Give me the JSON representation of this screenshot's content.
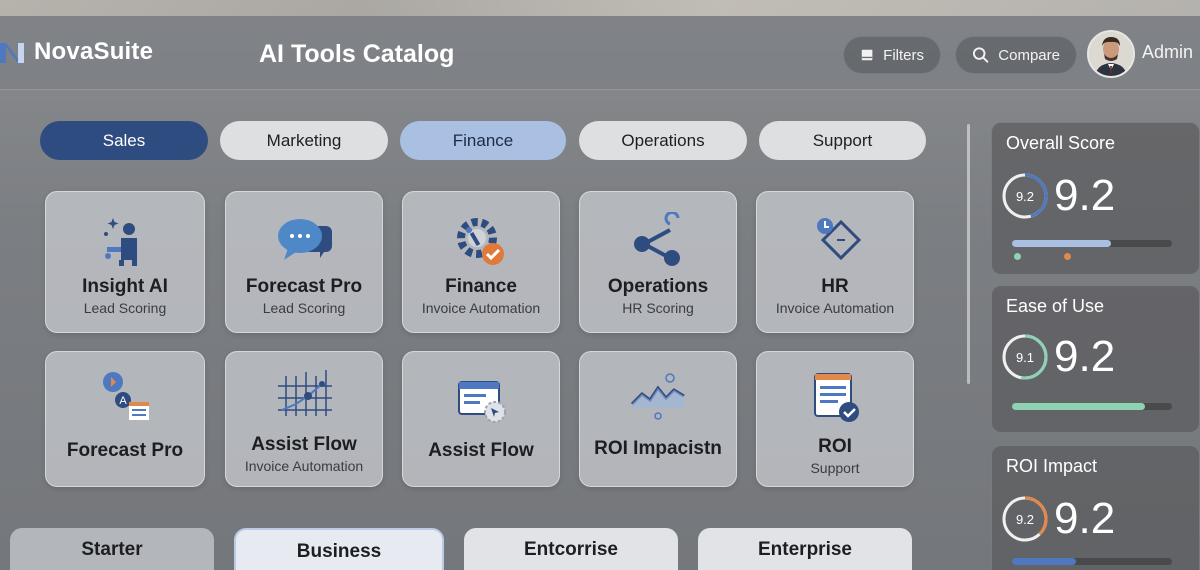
{
  "app": {
    "name": "NovaSuite",
    "title": "AI Tools Catalog"
  },
  "header": {
    "filters_label": "Filters",
    "compare_label": "Compare",
    "user_label": "Admin"
  },
  "tabs": [
    {
      "label": "Sales",
      "state": "active"
    },
    {
      "label": "Marketing",
      "state": "default"
    },
    {
      "label": "Finance",
      "state": "highlighted"
    },
    {
      "label": "Operations",
      "state": "default"
    },
    {
      "label": "Support",
      "state": "default"
    }
  ],
  "tools": [
    {
      "title": "Insight AI",
      "subtitle": "Lead Scoring",
      "icon": "person-sparkle-icon"
    },
    {
      "title": "Forecast Pro",
      "subtitle": "Lead Scoring",
      "icon": "chat-bubbles-icon"
    },
    {
      "title": "Finance",
      "subtitle": "Invoice Automation",
      "icon": "gear-check-icon"
    },
    {
      "title": "Operations",
      "subtitle": "HR Scoring",
      "icon": "share-nodes-icon"
    },
    {
      "title": "HR",
      "subtitle": "Invoice Automation",
      "icon": "diamond-clock-icon"
    },
    {
      "title": "Forecast Pro",
      "subtitle": "",
      "icon": "translate-doc-icon"
    },
    {
      "title": "Assist Flow",
      "subtitle": "Invoice Automation",
      "icon": "scatter-grid-icon"
    },
    {
      "title": "Assist Flow",
      "subtitle": "",
      "icon": "window-cursor-icon"
    },
    {
      "title": "ROI Impacistn",
      "subtitle": "",
      "icon": "line-trend-icon"
    },
    {
      "title": "ROI",
      "subtitle": "Support",
      "icon": "document-check-icon"
    }
  ],
  "scores": [
    {
      "label": "Overall Score",
      "ring_value": "9.2",
      "value": "9.2",
      "level": 0.62,
      "bar_color": "#a9c0e3",
      "ring_color": "#4e78c0"
    },
    {
      "label": "Ease of Use",
      "ring_value": "9.1",
      "value": "9.2",
      "level": 0.83,
      "bar_color": "#8fd1b3",
      "ring_color": "#8fd1b3"
    },
    {
      "label": "ROI Impact",
      "ring_value": "9.2",
      "value": "9.2",
      "level": 0.4,
      "bar_color": "#4e78c0",
      "ring_color": "#e0894a"
    }
  ],
  "plans": [
    {
      "label": "Starter"
    },
    {
      "label": "Business"
    },
    {
      "label": "Entcorrise"
    },
    {
      "label": "Enterprise"
    }
  ],
  "colors": {
    "accent": "#2f4c80",
    "highlight": "#a9c0e3",
    "orange": "#e0894a",
    "green": "#8fd1b3"
  }
}
